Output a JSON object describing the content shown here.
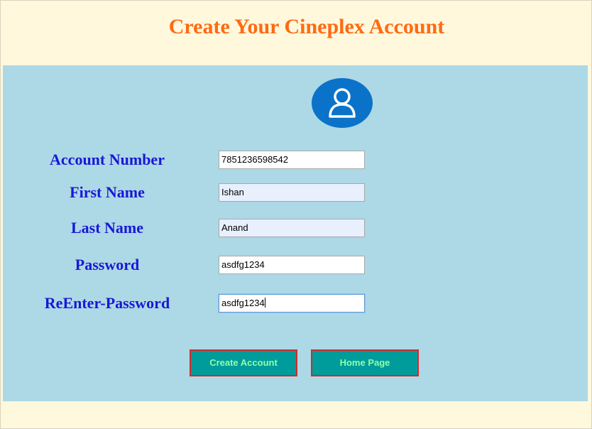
{
  "page": {
    "title": "Create Your Cineplex Account"
  },
  "form": {
    "avatar_icon": "user-icon",
    "colors": {
      "title": "#ff6a13",
      "panel_bg": "#add8e6",
      "label": "#1818d6",
      "avatar_bg": "#0a73c9",
      "button_bg": "#009b9b",
      "button_text": "#8fffa8",
      "button_border": "#d42a2a",
      "page_bg": "#fff8dc"
    },
    "fields": [
      {
        "label": "Account Number",
        "value": "7851236598542"
      },
      {
        "label": "First Name",
        "value": "Ishan"
      },
      {
        "label": "Last Name",
        "value": "Anand"
      },
      {
        "label": "Password",
        "value": "asdfg1234"
      },
      {
        "label": "ReEnter-Password",
        "value": "asdfg1234"
      }
    ],
    "buttons": {
      "create_account": "Create Account",
      "home_page": "Home Page"
    }
  }
}
